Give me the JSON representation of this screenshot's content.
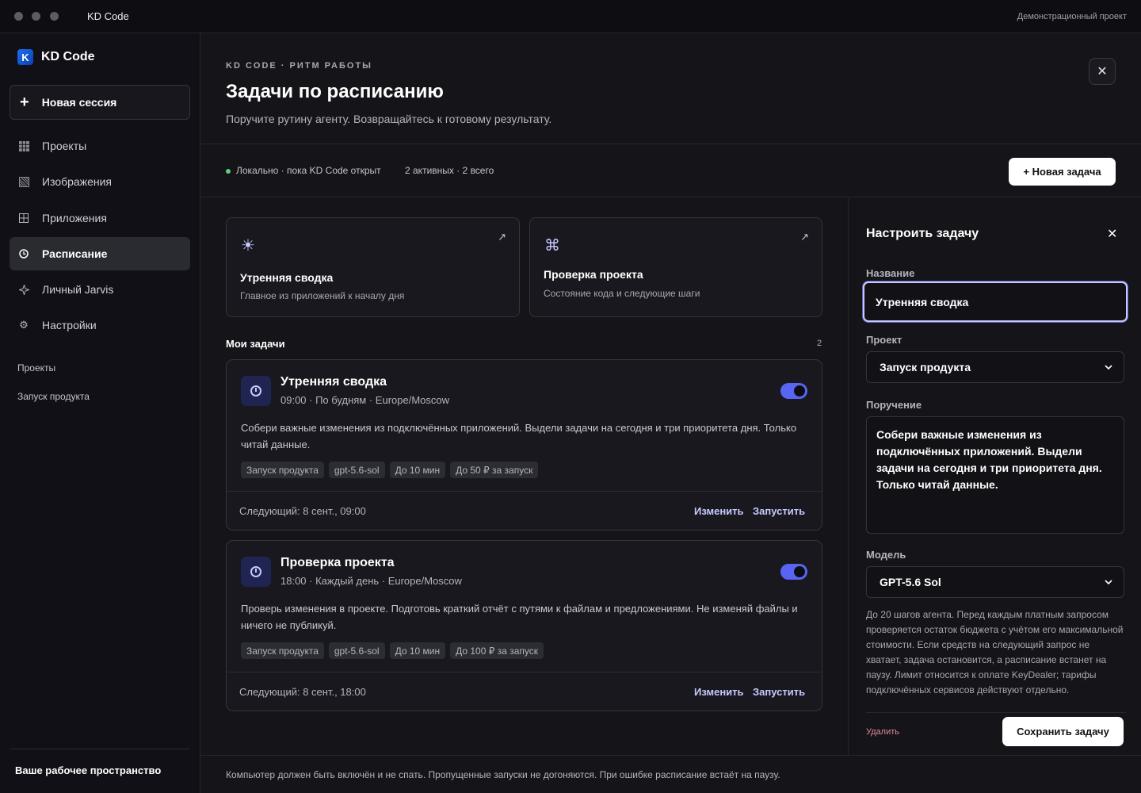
{
  "titlebar": {
    "app_title": "KD Code",
    "project_label": "Демонстрационный проект"
  },
  "sidebar": {
    "brand": "KD Code",
    "brand_logo": "K",
    "new_session": "Новая сессия",
    "items": [
      {
        "label": "Проекты",
        "icon": "grid-icon"
      },
      {
        "label": "Изображения",
        "icon": "image-icon"
      },
      {
        "label": "Приложения",
        "icon": "apps-icon"
      },
      {
        "label": "Расписание",
        "icon": "clock-icon",
        "active": true
      },
      {
        "label": "Личный Jarvis",
        "icon": "sparkle-icon"
      },
      {
        "label": "Настройки",
        "icon": "gear-icon"
      }
    ],
    "section_title": "Проекты",
    "projects": [
      "Запуск продукта"
    ],
    "footer": "Ваше рабочее пространство"
  },
  "header": {
    "eyebrow": "KD CODE · РИТМ РАБОТЫ",
    "title": "Задачи по расписанию",
    "subtitle": "Поручите рутину агенту. Возвращайтесь к готовому результату."
  },
  "status": {
    "local": "Локально · пока KD Code открыт",
    "counts": "2 активных · 2 всего",
    "new_task_button": "+ Новая задача",
    "dot_color": "#5fd07a"
  },
  "templates": [
    {
      "icon": "sun-icon",
      "glyph": "☀",
      "title": "Утренняя сводка",
      "desc": "Главное из приложений к началу дня"
    },
    {
      "icon": "command-icon",
      "glyph": "⌘",
      "title": "Проверка проекта",
      "desc": "Состояние кода и следующие шаги"
    }
  ],
  "tasks_section": {
    "title": "Мои задачи",
    "count": "2"
  },
  "tasks": [
    {
      "name": "Утренняя сводка",
      "meta": "09:00 · По будням · Europe/Moscow",
      "prompt": "Собери важные изменения из подключённых приложений. Выдели задачи на сегодня и три приоритета дня. Только читай данные.",
      "tags": [
        "Запуск продукта",
        "gpt-5.6-sol",
        "До 10 мин",
        "До 50 ₽ за запуск"
      ],
      "next": "Следующий: 8 сент., 09:00",
      "edit": "Изменить",
      "run": "Запустить",
      "enabled": true
    },
    {
      "name": "Проверка проекта",
      "meta": "18:00 · Каждый день · Europe/Moscow",
      "prompt": "Проверь изменения в проекте. Подготовь краткий отчёт с путями к файлам и предложениями. Не изменяй файлы и ничего не публикуй.",
      "tags": [
        "Запуск продукта",
        "gpt-5.6-sol",
        "До 10 мин",
        "До 100 ₽ за запуск"
      ],
      "next": "Следующий: 8 сент., 18:00",
      "edit": "Изменить",
      "run": "Запустить",
      "enabled": true
    }
  ],
  "panel": {
    "title": "Настроить задачу",
    "name_label": "Название",
    "name_value": "Утренняя сводка",
    "project_label": "Проект",
    "project_value": "Запуск продукта",
    "prompt_label": "Поручение",
    "prompt_value": "Собери важные изменения из подключённых приложений. Выдели задачи на сегодня и три приоритета дня. Только читай данные.",
    "model_label": "Модель",
    "model_value": "GPT-5.6 Sol",
    "hint": "До 20 шагов агента. Перед каждым платным запросом проверяется остаток бюджета с учётом его максимальной стоимости. Если средств на следующий запрос не хватает, задача остановится, а расписание встанет на паузу. Лимит относится к оплате KeyDealer; тарифы подключённых сервисов действуют отдельно.",
    "delete": "Удалить",
    "save": "Сохранить задачу"
  },
  "footer_note": "Компьютер должен быть включён и не спать. Пропущенные запуски не догоняются. При ошибке расписание встаёт на паузу.",
  "colors": {
    "accent": "#5865f2",
    "accent_text": "#c7c9ff",
    "danger": "#e58a9e"
  }
}
